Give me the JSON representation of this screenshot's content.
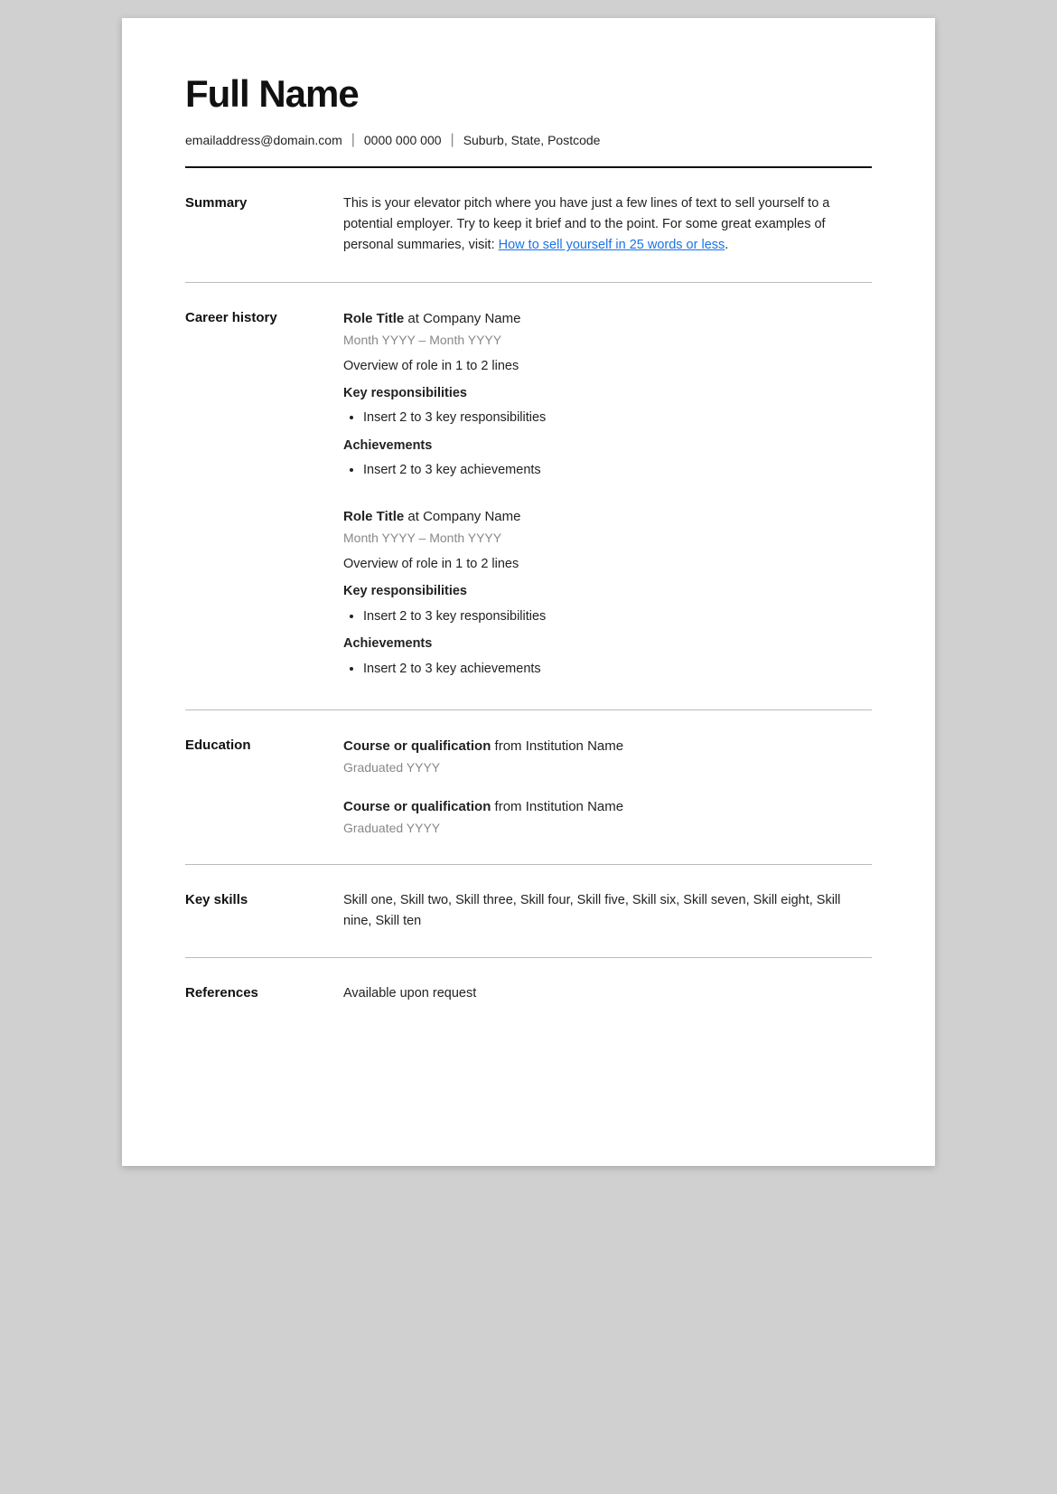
{
  "header": {
    "full_name": "Full Name",
    "email": "emailaddress@domain.com",
    "phone": "0000 000 000",
    "location": "Suburb, State, Postcode"
  },
  "summary": {
    "label": "Summary",
    "text_before_link": "This is your elevator pitch where you have just a few lines of text to sell yourself to a potential employer. Try to keep it brief and to the point. For some great examples of personal summaries, visit: ",
    "link_text": "How to sell yourself in 25 words or less",
    "text_after_link": "."
  },
  "career_history": {
    "label": "Career history",
    "jobs": [
      {
        "title": "Role Title",
        "company": " at Company Name",
        "dates": "Month YYYY – Month YYYY",
        "overview": "Overview of role in 1 to 2 lines",
        "responsibilities_label": "Key responsibilities",
        "responsibilities": [
          "Insert 2 to 3 key responsibilities"
        ],
        "achievements_label": "Achievements",
        "achievements": [
          "Insert 2 to 3 key achievements"
        ]
      },
      {
        "title": "Role Title",
        "company": " at Company Name",
        "dates": "Month YYYY – Month YYYY",
        "overview": "Overview of role in 1 to 2 lines",
        "responsibilities_label": "Key responsibilities",
        "responsibilities": [
          "Insert 2 to 3 key responsibilities"
        ],
        "achievements_label": "Achievements",
        "achievements": [
          "Insert 2 to 3 key achievements"
        ]
      }
    ]
  },
  "education": {
    "label": "Education",
    "entries": [
      {
        "course": "Course or qualification",
        "institution": " from Institution Name",
        "graduated": "Graduated YYYY"
      },
      {
        "course": "Course or qualification",
        "institution": " from Institution Name",
        "graduated": "Graduated YYYY"
      }
    ]
  },
  "key_skills": {
    "label": "Key skills",
    "text": "Skill one, Skill two, Skill three, Skill four, Skill five, Skill six, Skill seven, Skill eight, Skill nine, Skill ten"
  },
  "references": {
    "label": "References",
    "text": "Available upon request"
  },
  "separators": {
    "pipe": "|"
  }
}
